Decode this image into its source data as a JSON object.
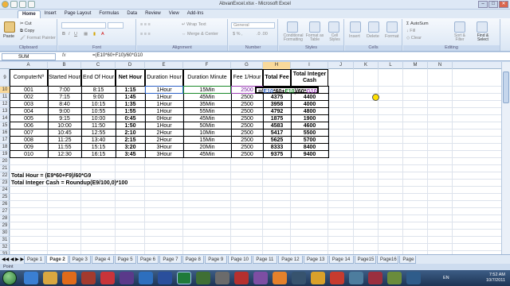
{
  "window": {
    "title": "AbvanExcel.xlsx - Microsoft Excel"
  },
  "tabs": [
    "Home",
    "Insert",
    "Page Layout",
    "Formulas",
    "Data",
    "Review",
    "View",
    "Add-Ins"
  ],
  "ribbon": {
    "paste": "Paste",
    "cut": "Cut",
    "copy": "Copy",
    "format_painter": "Format Painter",
    "clipboard": "Clipboard",
    "font_group": "Font",
    "alignment_group": "Alignment",
    "wrap_text": "Wrap Text",
    "merge_center": "Merge & Center",
    "number_format": "General",
    "number_group": "Number",
    "conditional_formatting": "Conditional Formatting",
    "format_as_table": "Format as Table",
    "cell_styles": "Cell Styles",
    "styles_group": "Styles",
    "insert": "Insert",
    "delete": "Delete",
    "format": "Format",
    "cells_group": "Cells",
    "autosum": "AutoSum",
    "fill": "Fill",
    "clear": "Clear",
    "sort_filter": "Sort & Filter",
    "find_select": "Find & Select",
    "editing_group": "Editing"
  },
  "formula_bar": {
    "name_box": "SUM",
    "fx": "fx",
    "formula": "=(E10*60+F10)/60*G10"
  },
  "columns": [
    "A",
    "B",
    "C",
    "D",
    "E",
    "F",
    "G",
    "H",
    "I",
    "J",
    "K",
    "L",
    "M",
    "N"
  ],
  "rows": [
    "9",
    "10",
    "11",
    "12",
    "13",
    "14",
    "15",
    "16",
    "17",
    "18",
    "19",
    "20",
    "21",
    "22",
    "23",
    "24",
    "25",
    "26",
    "27",
    "28",
    "29",
    "30",
    "31",
    "32",
    "33"
  ],
  "table": {
    "headers": [
      "ComputerNº",
      "Started Hour",
      "End Of Hour",
      "Net Hour",
      "Duration Hour",
      "Duration Minute",
      "Fee 1/Hour",
      "Total Fee",
      "Total Integer Cash"
    ],
    "rows": [
      [
        "001",
        "7:00",
        "8:15",
        "1:15",
        "1Hour",
        "15Min",
        "",
        "=(E10*60+F10)/60*G10",
        ""
      ],
      [
        "002",
        "7:15",
        "9:00",
        "1:45",
        "1Hour",
        "45Min",
        "2500",
        "4375",
        "4400"
      ],
      [
        "003",
        "8:40",
        "10:15",
        "1:35",
        "1Hour",
        "35Min",
        "2500",
        "3958",
        "4000"
      ],
      [
        "004",
        "9:00",
        "10:55",
        "1:55",
        "1Hour",
        "55Min",
        "2500",
        "4792",
        "4800"
      ],
      [
        "005",
        "9:15",
        "10:00",
        "0:45",
        "0Hour",
        "45Min",
        "2500",
        "1875",
        "1900"
      ],
      [
        "006",
        "10:00",
        "11:50",
        "1:50",
        "1Hour",
        "50Min",
        "2500",
        "4583",
        "4600"
      ],
      [
        "007",
        "10:45",
        "12:55",
        "2:10",
        "2Hour",
        "10Min",
        "2500",
        "5417",
        "5500"
      ],
      [
        "008",
        "11:25",
        "13:40",
        "2:15",
        "2Hour",
        "15Min",
        "2500",
        "5625",
        "5700"
      ],
      [
        "009",
        "11:55",
        "15:15",
        "3:20",
        "3Hour",
        "20Min",
        "2500",
        "8333",
        "8400"
      ],
      [
        "010",
        "12:30",
        "16:15",
        "3:45",
        "3Hour",
        "45Min",
        "2500",
        "9375",
        "9400"
      ]
    ],
    "g10_fee": "2500"
  },
  "notes": [
    "Total Hour = (E9*60+F9)/60*G9",
    "Total Integer Cash = Roundup(E9/100,0)*100"
  ],
  "sheets": [
    "Page 1",
    "Page 2",
    "Page 3",
    "Page 4",
    "Page 5",
    "Page 6",
    "Page 7",
    "Page 8",
    "Page 9",
    "Page 10",
    "Page 11",
    "Page 12",
    "Page 13",
    "Page 14",
    "Page15",
    "Page16",
    "Page"
  ],
  "status": "Point",
  "tray": {
    "lang": "EN",
    "time": "7:52 AM",
    "date": "10/7/2011"
  }
}
